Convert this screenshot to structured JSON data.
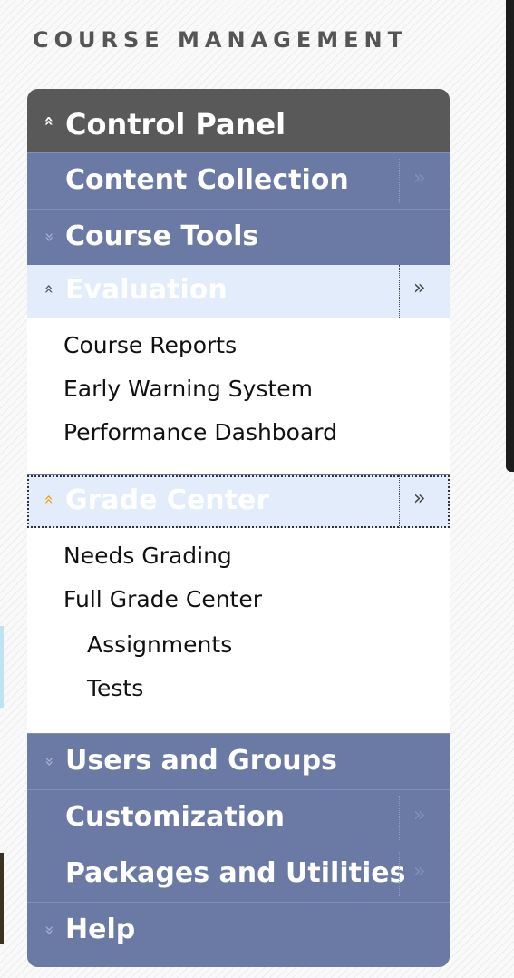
{
  "heading": "COURSE MANAGEMENT",
  "control_panel": {
    "label": "Control Panel",
    "chevron": "«"
  },
  "content_collection": {
    "label": "Content Collection",
    "arrow": "»"
  },
  "course_tools": {
    "label": "Course Tools",
    "chevron": "«"
  },
  "evaluation": {
    "label": "Evaluation",
    "chevron": "«",
    "arrow": "»",
    "items": [
      "Course Reports",
      "Early Warning System",
      "Performance Dashboard"
    ]
  },
  "grade_center": {
    "label": "Grade Center",
    "chevron": "«",
    "arrow": "»",
    "items": [
      "Needs Grading",
      "Full Grade Center"
    ],
    "subitems": [
      "Assignments",
      "Tests"
    ]
  },
  "users_and_groups": {
    "label": "Users and Groups",
    "chevron": "«"
  },
  "customization": {
    "label": "Customization",
    "arrow": "»"
  },
  "packages_and_utilities": {
    "label": "Packages and Utilities",
    "arrow": "»"
  },
  "help": {
    "label": "Help",
    "chevron": "«"
  },
  "colors": {
    "nav_bar": "#6a7aa4",
    "control_panel_bar": "#595959",
    "section_bar": "#e2ecfb",
    "grade_center_chevron": "#f4a000"
  }
}
